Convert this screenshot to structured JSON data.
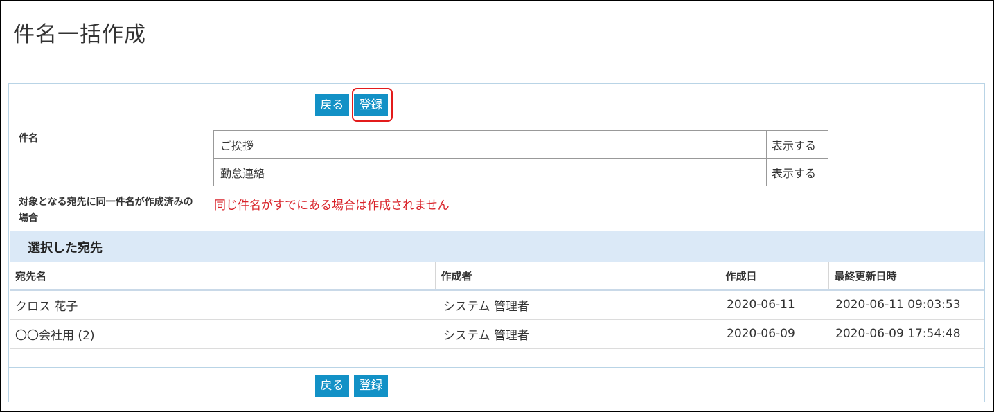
{
  "page": {
    "title": "件名一括作成"
  },
  "buttons": {
    "back_label": "戻る",
    "register_label": "登録"
  },
  "subject": {
    "label": "件名",
    "rows": [
      {
        "name": "ご挨拶",
        "action": "表示する"
      },
      {
        "name": "勤怠連絡",
        "action": "表示する"
      }
    ]
  },
  "duplicate_rule": {
    "label": "対象となる宛先に同一件名が作成済みの場合",
    "value": "同じ件名がすでにある場合は作成されません"
  },
  "selected_destinations": {
    "title": "選択した宛先",
    "columns": [
      "宛先名",
      "作成者",
      "作成日",
      "最終更新日時"
    ],
    "rows": [
      {
        "name": "クロス 花子",
        "creator": "システム 管理者",
        "created": "2020-06-11",
        "updated": "2020-06-11 09:03:53"
      },
      {
        "name": "〇〇会社用 (2)",
        "creator": "システム 管理者",
        "created": "2020-06-09",
        "updated": "2020-06-09 17:54:48"
      }
    ]
  },
  "colors": {
    "button_bg": "#1291c6",
    "highlight": "#e31b1b",
    "warning_text": "#d9232a",
    "section_bg": "#dbe9f7",
    "panel_border": "#b9d4e6"
  }
}
